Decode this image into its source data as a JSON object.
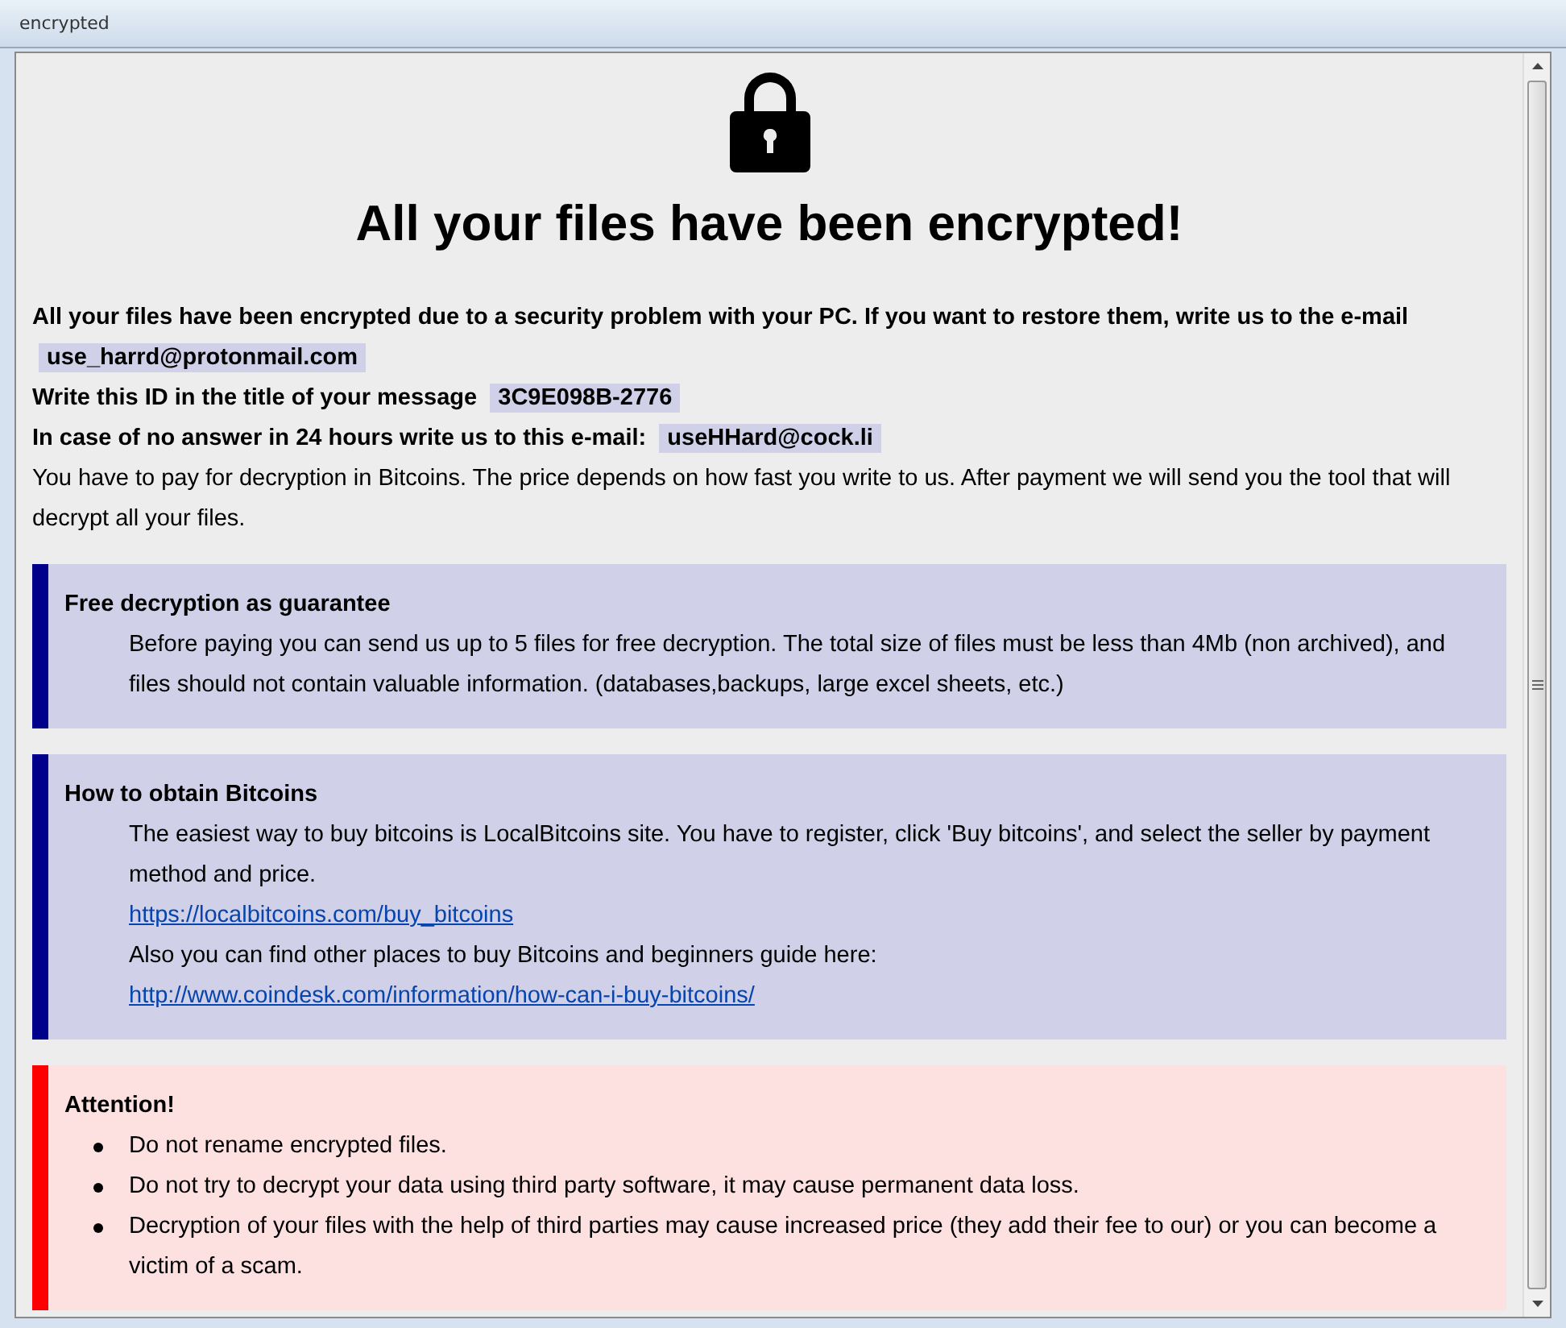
{
  "window": {
    "title": "encrypted"
  },
  "heading": "All your files have been encrypted!",
  "contacts": [
    {
      "label": "All your files have been encrypted due to a security problem with your PC. If you want to restore them, write us to the e-mail",
      "value": "use_harrd@protonmail.com"
    },
    {
      "label": "Write this ID in the title of your message",
      "value": "3C9E098B-2776"
    },
    {
      "label": "In case of no answer in 24 hours write us to this e-mail:",
      "value": "useHHard@cock.li"
    }
  ],
  "paragraph": "You have to pay for decryption in Bitcoins. The price depends on how fast you write to us. After payment we will send you the tool that will decrypt all your files.",
  "sections": [
    {
      "kind": "info",
      "title": "Free decryption as guarantee",
      "lines": [
        {
          "kind": "text",
          "text": "Before paying you can send us up to 5 files for free decryption. The total size of files must be less than 4Mb (non archived), and files should not contain valuable information. (databases,backups, large excel sheets, etc.)"
        }
      ]
    },
    {
      "kind": "info",
      "title": "How to obtain Bitcoins",
      "lines": [
        {
          "kind": "text",
          "text": "The easiest way to buy bitcoins is LocalBitcoins site. You have to register, click 'Buy bitcoins', and select the seller by payment method and price."
        },
        {
          "kind": "link",
          "text": "https://localbitcoins.com/buy_bitcoins"
        },
        {
          "kind": "text",
          "text": "Also you can find other places to buy Bitcoins and beginners guide here:"
        },
        {
          "kind": "link",
          "text": "http://www.coindesk.com/information/how-can-i-buy-bitcoins/"
        }
      ]
    },
    {
      "kind": "warning",
      "title": "Attention!",
      "lines": [
        {
          "kind": "bullet",
          "text": "Do not rename encrypted files."
        },
        {
          "kind": "bullet",
          "text": "Do not try to decrypt your data using third party software, it may cause permanent data loss."
        },
        {
          "kind": "bullet",
          "text": "Decryption of your files with the help of third parties may cause increased price (they add their fee to our) or you can become a victim of a scam."
        }
      ]
    }
  ]
}
